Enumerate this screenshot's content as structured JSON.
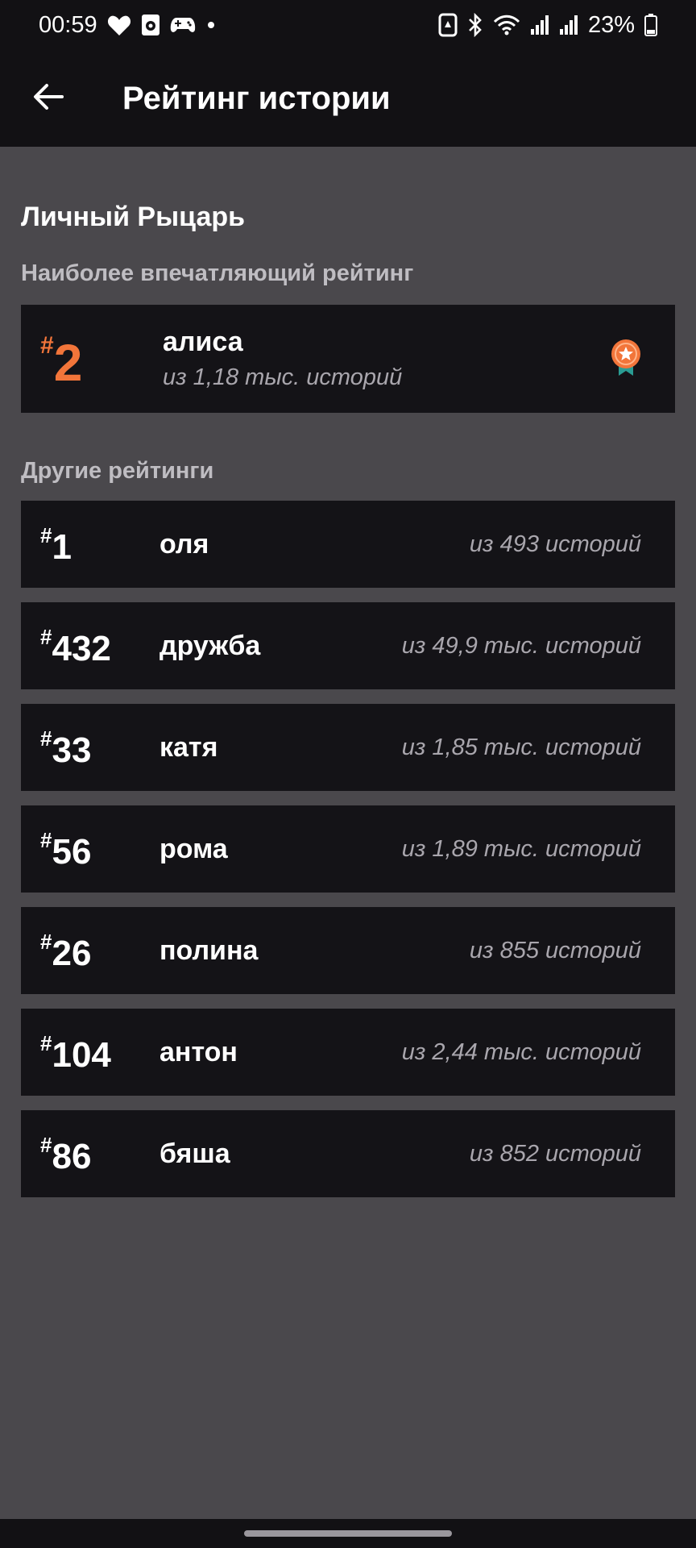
{
  "status_bar": {
    "time": "00:59",
    "battery": "23%",
    "icons_left": [
      "heart-icon",
      "media-icon",
      "gamepad-icon",
      "dot-icon"
    ],
    "icons_right": [
      "recycle-icon",
      "bluetooth-icon",
      "wifi-icon",
      "signal-icon",
      "signal-icon",
      "battery-icon"
    ]
  },
  "app_bar": {
    "title": "Рейтинг истории",
    "back_icon": "arrow-left-icon"
  },
  "personal": {
    "title": "Личный Рыцарь",
    "subtitle": "Наиболее впечатляющий рейтинг",
    "featured": {
      "hash": "#",
      "rank": "2",
      "name": "алиса",
      "count": "из 1,18 тыс. историй",
      "badge_icon": "medal-star-icon",
      "accent": "#f2753a"
    }
  },
  "others": {
    "title": "Другие рейтинги",
    "items": [
      {
        "hash": "#",
        "rank": "1",
        "name": "оля",
        "count": "из 493 историй"
      },
      {
        "hash": "#",
        "rank": "432",
        "name": "дружба",
        "count": "из 49,9 тыс. историй"
      },
      {
        "hash": "#",
        "rank": "33",
        "name": "катя",
        "count": "из 1,85 тыс. историй"
      },
      {
        "hash": "#",
        "rank": "56",
        "name": "рома",
        "count": "из 1,89 тыс. историй"
      },
      {
        "hash": "#",
        "rank": "26",
        "name": "полина",
        "count": "из 855 историй"
      },
      {
        "hash": "#",
        "rank": "104",
        "name": "антон",
        "count": "из 2,44 тыс. историй"
      },
      {
        "hash": "#",
        "rank": "86",
        "name": "бяша",
        "count": "из 852 историй"
      }
    ]
  },
  "colors": {
    "background": "#4a484c",
    "card": "#141317",
    "bar": "#121114",
    "accent": "#f2753a"
  }
}
